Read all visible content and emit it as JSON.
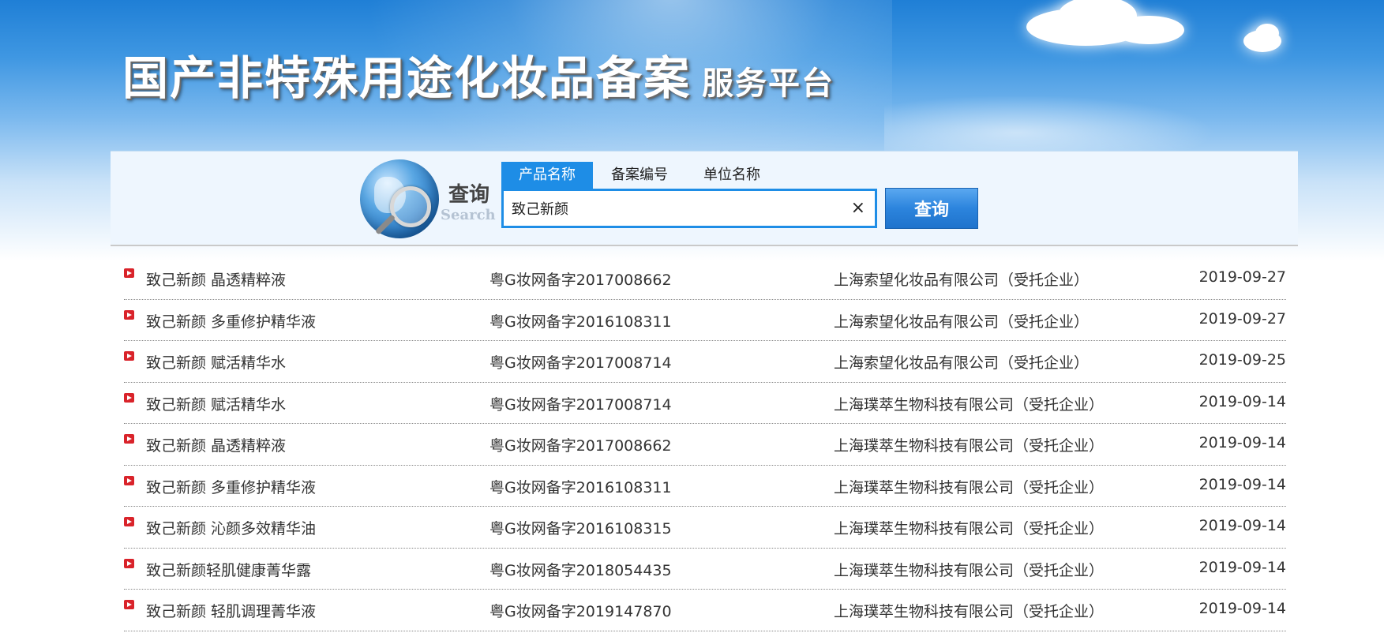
{
  "banner": {
    "title_main": "国产非特殊用途化妆品备案",
    "title_sub": "服务平台"
  },
  "search": {
    "logo_cn": "查询",
    "logo_en": "Search",
    "tabs": [
      "产品名称",
      "备案编号",
      "单位名称"
    ],
    "active_tab": "产品名称",
    "query": "致己新颜",
    "clear_symbol": "×",
    "button_label": "查询"
  },
  "results": [
    {
      "name": "致己新颜 晶透精粹液",
      "code": "粤G妆网备字2017008662",
      "company": "上海索望化妆品有限公司（受托企业）",
      "date": "2019-09-27"
    },
    {
      "name": "致己新颜 多重修护精华液",
      "code": "粤G妆网备字2016108311",
      "company": "上海索望化妆品有限公司（受托企业）",
      "date": "2019-09-27"
    },
    {
      "name": "致己新颜 赋活精华水",
      "code": "粤G妆网备字2017008714",
      "company": "上海索望化妆品有限公司（受托企业）",
      "date": "2019-09-25"
    },
    {
      "name": "致己新颜 赋活精华水",
      "code": "粤G妆网备字2017008714",
      "company": "上海璞萃生物科技有限公司（受托企业）",
      "date": "2019-09-14"
    },
    {
      "name": "致己新颜 晶透精粹液",
      "code": "粤G妆网备字2017008662",
      "company": "上海璞萃生物科技有限公司（受托企业）",
      "date": "2019-09-14"
    },
    {
      "name": "致己新颜 多重修护精华液",
      "code": "粤G妆网备字2016108311",
      "company": "上海璞萃生物科技有限公司（受托企业）",
      "date": "2019-09-14"
    },
    {
      "name": "致己新颜 沁颜多效精华油",
      "code": "粤G妆网备字2016108315",
      "company": "上海璞萃生物科技有限公司（受托企业）",
      "date": "2019-09-14"
    },
    {
      "name": "致己新颜轻肌健康菁华露",
      "code": "粤G妆网备字2018054435",
      "company": "上海璞萃生物科技有限公司（受托企业）",
      "date": "2019-09-14"
    },
    {
      "name": "致己新颜 轻肌调理菁华液",
      "code": "粤G妆网备字2019147870",
      "company": "上海璞萃生物科技有限公司（受托企业）",
      "date": "2019-09-14"
    }
  ],
  "icons": {
    "bullet": "red-arrow-bullet-icon",
    "clear": "close-icon",
    "logo": "globe-magnifier-icon"
  },
  "colors": {
    "accent": "#1e8de6",
    "bullet": "#d9232a"
  }
}
